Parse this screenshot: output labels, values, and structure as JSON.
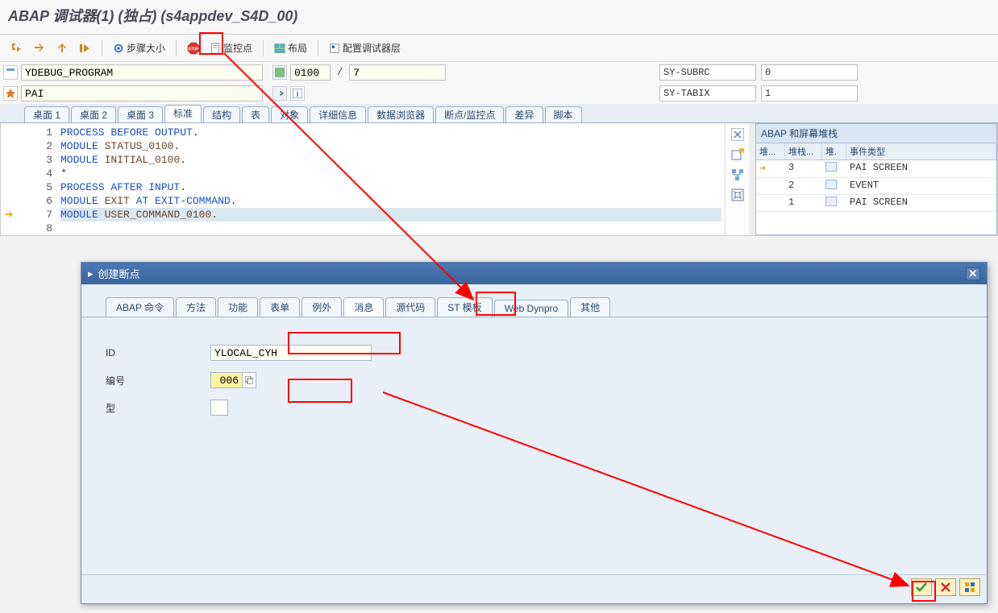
{
  "title": "ABAP 调试器(1) (独占) (s4appdev_S4D_00)",
  "toolbar": {
    "step_size": "步骤大小",
    "watchpoint": "监控点",
    "layout": "布局",
    "config_debugger": "配置调试器层"
  },
  "program_field": "YDEBUG_PROGRAM",
  "screen_field": "0100",
  "slash": "/",
  "seven": "7",
  "pai_field": "PAI",
  "sys": {
    "subrc_label": "SY-SUBRC",
    "subrc_value": "0",
    "tabix_label": "SY-TABIX",
    "tabix_value": "1"
  },
  "main_tabs": [
    "桌面 1",
    "桌面 2",
    "桌面 3",
    "标准",
    "结构",
    "表",
    "对象",
    "详细信息",
    "数据浏览器",
    "断点/监控点",
    "差异",
    "脚本"
  ],
  "code": {
    "lines": [
      {
        "n": 1,
        "html": "<span class='kw'>PROCESS BEFORE OUTPUT</span>."
      },
      {
        "n": 2,
        "html": "  <span class='kw'>MODULE</span> <span class='id'>STATUS_0100</span>."
      },
      {
        "n": 3,
        "html": "  <span class='kw'>MODULE</span> <span class='id'>INITIAL_0100</span>."
      },
      {
        "n": 4,
        "html": "*"
      },
      {
        "n": 5,
        "html": "<span class='kw'>PROCESS AFTER INPUT</span>."
      },
      {
        "n": 6,
        "html": "  <span class='kw'>MODULE</span> <span class='id'>EXIT</span> <span class='kw'>AT EXIT-COMMAND</span>."
      },
      {
        "n": 7,
        "html": "  <span class='kw'>MODULE</span> <span class='id'>USER_COMMAND_0100</span>."
      },
      {
        "n": 8,
        "html": ""
      }
    ]
  },
  "stack": {
    "title": "ABAP 和屏幕堆栈",
    "headers": [
      "堆...",
      "堆栈...",
      "堆.",
      "事件类型"
    ],
    "rows": [
      {
        "cur": true,
        "a": "",
        "b": "3",
        "c": "",
        "d": "PAI SCREEN"
      },
      {
        "cur": false,
        "a": "",
        "b": "2",
        "c": "",
        "d": "EVENT"
      },
      {
        "cur": false,
        "a": "",
        "b": "1",
        "c": "",
        "d": "PAI SCREEN"
      }
    ]
  },
  "dialog": {
    "title": "创建断点",
    "tabs": [
      "ABAP 命令",
      "方法",
      "功能",
      "表单",
      "例外",
      "消息",
      "源代码",
      "ST 模板",
      "Web Dynpro",
      "其他"
    ],
    "active_tab": "消息",
    "form": {
      "id_label": "ID",
      "id_value": "YLOCAL_CYH",
      "num_label": "编号",
      "num_value": "006",
      "type_label": "型",
      "type_value": ""
    }
  }
}
